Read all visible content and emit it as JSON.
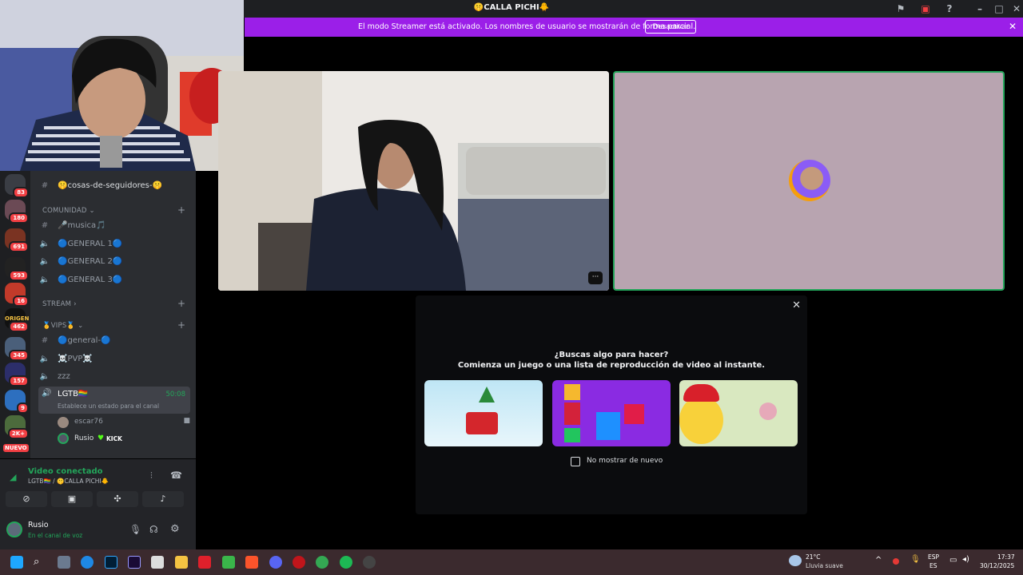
{
  "window": {
    "title": "🤫CALLA PICHI🐥"
  },
  "streamer_banner": {
    "text": "El modo Streamer está activado. Los nombres de usuario se mostrarán de forma parcial.",
    "button": "Desactivar"
  },
  "servers": [
    {
      "badge": "83",
      "color": "#3a3d44"
    },
    {
      "badge": "180",
      "color": "#6b4a55"
    },
    {
      "badge": "691",
      "color": "#7a3322"
    },
    {
      "badge": "593",
      "color": "#222"
    },
    {
      "badge": "16",
      "color": "#c23a2a"
    },
    {
      "badge": "462",
      "color": "#111"
    },
    {
      "badge": "345",
      "color": "#4a5f7a"
    },
    {
      "badge": "157",
      "color": "#2c2e6a"
    },
    {
      "badge": "9",
      "color": "#2d6fbf"
    },
    {
      "badge": "2K+",
      "color": "#4c6b3c"
    },
    {
      "badge": "NUEVO",
      "color": "#f23f43"
    }
  ],
  "server_labels": {
    "origen": "ORIGEN"
  },
  "channels": {
    "cosas": "🤫cosas-de-seguidores-🤫",
    "cat_comunidad": "COMUNIDAD",
    "musica": "🎤musica🎵",
    "general1": "🔵GENERAL 1🔵",
    "general2": "🔵GENERAL 2🔵",
    "general3": "🔵GENERAL 3🔵",
    "cat_stream": "STREAM",
    "cat_vips": "🥇VIPS🥇",
    "general_vip": "🔵general-🔵",
    "pvp": "☠️PVP☠️",
    "zzz": "zzz",
    "active": "LGTB🏳️‍🌈",
    "active_time": "50:08",
    "active_status": "Establece un estado para el canal",
    "member1": "escar76",
    "member2": "Rusio",
    "kick": "KICK"
  },
  "voice": {
    "status": "Video conectado",
    "location": "LGTB🏳️‍🌈 / 🤫CALLA PICHI🐥"
  },
  "user": {
    "name": "Rusio",
    "status": "En el canal de voz"
  },
  "popup": {
    "line1": "¿Buscas algo para hacer?",
    "line2": "Comienza un juego o una lista de reproducción de video al instante.",
    "checkbox": "No mostrar de nuevo"
  },
  "tile": {
    "more": "···"
  },
  "taskbar": {
    "weather_temp": "21°C",
    "weather_desc": "Lluvia suave",
    "lang1": "ESP",
    "lang2": "ES",
    "time": "17:37",
    "date": "30/12/2025"
  },
  "colors": {
    "banner": "#9b1fe8",
    "speaking": "#23a55a",
    "discord_bg": "#2b2d31"
  }
}
